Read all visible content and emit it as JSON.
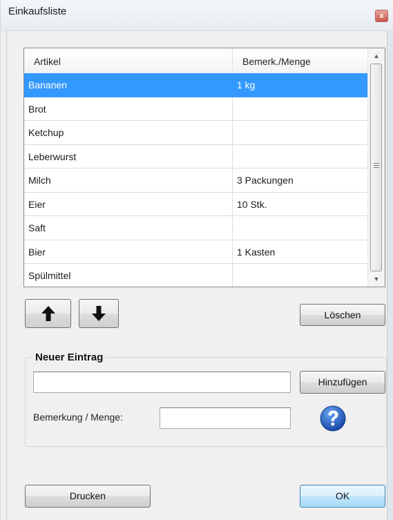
{
  "window": {
    "title": "Einkaufsliste",
    "close_glyph": "x"
  },
  "list": {
    "columns": [
      "Artikel",
      "Bemerk./Menge"
    ],
    "rows": [
      {
        "item": "Bananen",
        "note": "1 kg",
        "selected": true
      },
      {
        "item": "Brot",
        "note": ""
      },
      {
        "item": "Ketchup",
        "note": ""
      },
      {
        "item": "Leberwurst",
        "note": ""
      },
      {
        "item": "Milch",
        "note": "3 Packungen"
      },
      {
        "item": "Eier",
        "note": "10 Stk."
      },
      {
        "item": "Saft",
        "note": ""
      },
      {
        "item": "Bier",
        "note": "1 Kasten"
      },
      {
        "item": "Spülmittel",
        "note": ""
      }
    ]
  },
  "buttons": {
    "move_up_icon": "arrow-up-icon",
    "move_down_icon": "arrow-down-icon",
    "delete": "Löschen",
    "add": "Hinzufügen",
    "print": "Drucken",
    "ok": "OK"
  },
  "new_entry": {
    "title": "Neuer Eintrag",
    "item_value": "",
    "note_label": "Bemerkung / Menge:",
    "note_value": ""
  },
  "help": {
    "icon": "help-icon",
    "color": "#1f5fc4"
  },
  "colors": {
    "selection": "#3399ff",
    "window": "#f0f0f0"
  }
}
